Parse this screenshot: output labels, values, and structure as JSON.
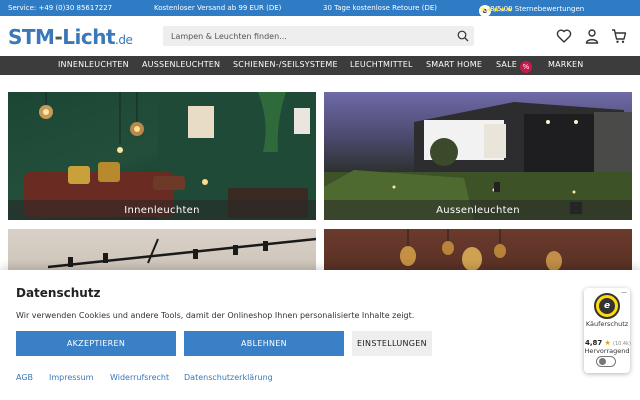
{
  "topbar": {
    "phone": "Service: +49 (0)30 85617227",
    "shipping": "Kostenloser Versand ab 99 EUR (DE)",
    "returns": "30 Tage kostenlose Retoure (DE)",
    "rating_badge": "e",
    "stars": "★★★★★",
    "rating_text": "4.88/5.00 Sternebewertungen"
  },
  "header": {
    "logo_main": "STM",
    "logo_dash": "-",
    "logo_second": "Licht",
    "logo_tld": ".de",
    "search_placeholder": "Lampen & Leuchten finden..."
  },
  "nav": {
    "items": [
      "INNENLEUCHTEN",
      "AUSSENLEUCHTEN",
      "SCHIENEN-/SEILSYSTEME",
      "LEUCHTMITTEL",
      "SMART HOME",
      "SALE",
      "MARKEN"
    ],
    "sale_badge": "%"
  },
  "tiles": [
    {
      "label": "Innenleuchten"
    },
    {
      "label": "Aussenleuchten"
    }
  ],
  "consent": {
    "title": "Datenschutz",
    "text": "Wir verwenden Cookies und andere Tools, damit der Onlineshop Ihnen personalisierte Inhalte zeigt.",
    "accept": "AKZEPTIEREN",
    "reject": "ABLEHNEN",
    "settings": "EINSTELLUNGEN",
    "links": [
      "AGB",
      "Impressum",
      "Widerrufsrecht",
      "Datenschutzerklärung"
    ]
  },
  "trusted_shops": {
    "seal": "e",
    "minimize": "—",
    "label": "Käuferschutz",
    "score": "4,87",
    "star": "★",
    "count": "(10.4k)",
    "grade": "Hervorragend"
  },
  "colors": {
    "topbar": "#2f7cc4",
    "nav": "#3c3c3c",
    "accent_button": "#3a80c7",
    "sale": "#c8184c"
  }
}
